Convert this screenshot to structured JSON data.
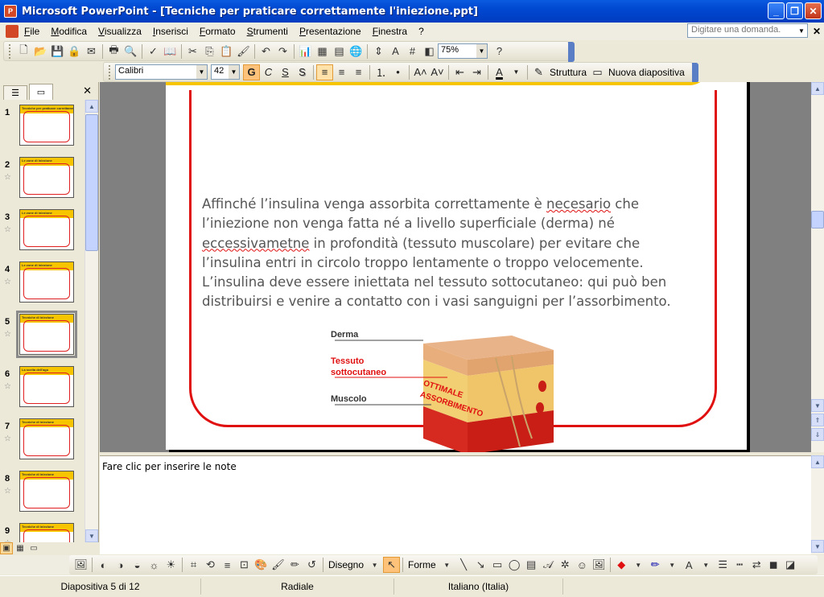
{
  "window": {
    "title": "Microsoft PowerPoint - [Tecniche per praticare correttamente l'iniezione.ppt]",
    "icon": "powerpoint-app-icon"
  },
  "menu": {
    "items": [
      "File",
      "Modifica",
      "Visualizza",
      "Inserisci",
      "Formato",
      "Strumenti",
      "Presentazione",
      "Finestra",
      "?"
    ],
    "help_placeholder": "Digitare una domanda."
  },
  "standard_toolbar": {
    "zoom": "75%"
  },
  "format_toolbar": {
    "font": "Calibri",
    "size": "42",
    "bold": "G",
    "italic": "C",
    "underline": "S",
    "shadow": "S",
    "design_label": "Struttura",
    "new_slide_label": "Nuova diapositiva"
  },
  "thumbnails": [
    {
      "num": "1",
      "title": "Tecniche per praticare correttamente l'iniezione"
    },
    {
      "num": "2",
      "title": "Le zone di iniezione"
    },
    {
      "num": "3",
      "title": "Le zone di iniezione"
    },
    {
      "num": "4",
      "title": "Le zone di iniezione"
    },
    {
      "num": "5",
      "title": "Tecniche di iniezione"
    },
    {
      "num": "6",
      "title": "La scelta dell'ago"
    },
    {
      "num": "7",
      "title": "Tecniche di iniezione"
    },
    {
      "num": "8",
      "title": "Tecniche di iniezione"
    },
    {
      "num": "9",
      "title": "Tecniche di iniezione"
    }
  ],
  "slide": {
    "p1": "Affinché l’insulina venga assorbita correttamente è ",
    "p1_err": "necesario",
    "p2": " che l’iniezione non venga fatta né a livello superficiale (derma) né ",
    "p2_err": "eccessivametne",
    "p3": " in profondità (tessuto muscolare) per evitare che l’insulina entri in circolo troppo lentamente o troppo velocemente. L’insulina deve essere iniettata nel tessuto sottocutaneo: qui può ben distribuirsi e venire a contatto con i vasi sanguigni per l’assorbimento.",
    "labels": {
      "derma": "Derma",
      "tessuto1": "Tessuto",
      "tessuto2": "sottocutaneo",
      "muscolo": "Muscolo",
      "cube1": "OTTIMALE",
      "cube2": "ASSORBIMENTO"
    }
  },
  "notes": {
    "placeholder": "Fare clic per inserire le note"
  },
  "drawing_toolbar": {
    "draw_label": "Disegno",
    "shapes_label": "Forme"
  },
  "status": {
    "slide": "Diapositiva 5 di 12",
    "design": "Radiale",
    "language": "Italiano (Italia)"
  }
}
